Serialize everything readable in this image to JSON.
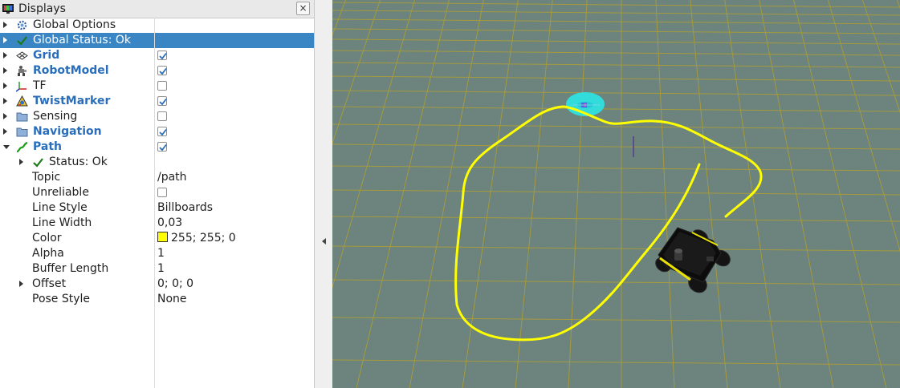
{
  "panel": {
    "title": "Displays",
    "close_label": "×"
  },
  "tree": [
    {
      "label": "Global Options",
      "indent": 0,
      "expander": "closed",
      "icon": "gear-icon",
      "bold": false,
      "selected": false
    },
    {
      "label": "Global Status: Ok",
      "indent": 0,
      "expander": "closed",
      "icon": "checkmark-icon",
      "bold": false,
      "selected": true
    },
    {
      "label": "Grid",
      "indent": 0,
      "expander": "closed",
      "icon": "grid-icon",
      "bold": true,
      "checked": true
    },
    {
      "label": "RobotModel",
      "indent": 0,
      "expander": "closed",
      "icon": "robot-model-icon",
      "bold": true,
      "checked": true
    },
    {
      "label": "TF",
      "indent": 0,
      "expander": "closed",
      "icon": "tf-axes-icon",
      "bold": false,
      "checked": false
    },
    {
      "label": "TwistMarker",
      "indent": 0,
      "expander": "closed",
      "icon": "marker-icon",
      "bold": true,
      "checked": true
    },
    {
      "label": "Sensing",
      "indent": 0,
      "expander": "closed",
      "icon": "folder-icon",
      "bold": false,
      "checked": false
    },
    {
      "label": "Navigation",
      "indent": 0,
      "expander": "closed",
      "icon": "folder-icon",
      "bold": true,
      "checked": true
    },
    {
      "label": "Path",
      "indent": 0,
      "expander": "open",
      "icon": "path-icon",
      "bold": true,
      "checked": true
    },
    {
      "label": "Status: Ok",
      "indent": 1,
      "expander": "closed",
      "icon": "checkmark-icon",
      "bold": false
    },
    {
      "label": "Topic",
      "indent": 1,
      "value": "/path"
    },
    {
      "label": "Unreliable",
      "indent": 1,
      "checked": false
    },
    {
      "label": "Line Style",
      "indent": 1,
      "value": "Billboards"
    },
    {
      "label": "Line Width",
      "indent": 1,
      "value": "0,03"
    },
    {
      "label": "Color",
      "indent": 1,
      "value": "255; 255; 0",
      "swatch": "#ffff00"
    },
    {
      "label": "Alpha",
      "indent": 1,
      "value": "1"
    },
    {
      "label": "Buffer Length",
      "indent": 1,
      "value": "1"
    },
    {
      "label": "Offset",
      "indent": 1,
      "expander": "closed",
      "value": "0; 0; 0"
    },
    {
      "label": "Pose Style",
      "indent": 1,
      "value": "None"
    }
  ],
  "colors": {
    "viewport_bg": "#6c847d",
    "grid_line": "#a59a3e",
    "path": "#ffff00",
    "marker": "#2fe0e0",
    "selection": "#3a86c4",
    "bold_label": "#2a6ebb"
  }
}
